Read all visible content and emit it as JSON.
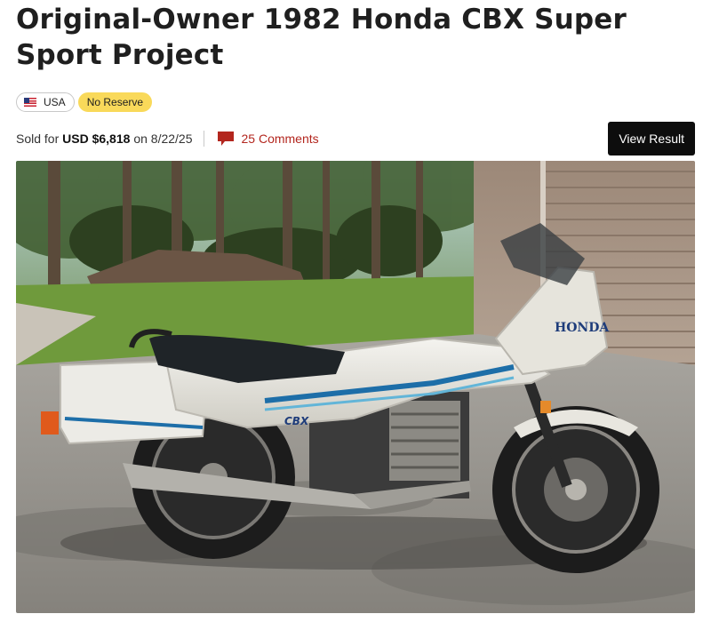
{
  "listing": {
    "title": "Original-Owner 1982 Honda CBX Super Sport Project",
    "tags": {
      "country": "USA",
      "country_flag_icon": "us-flag-icon",
      "reserve": "No Reserve"
    },
    "result": {
      "sold_prefix": "Sold for",
      "price": "USD $6,818",
      "date_prefix": "on",
      "date": "8/22/25"
    },
    "comments": {
      "icon": "comment-bubble-icon",
      "label": "25 Comments"
    },
    "view_result_label": "View Result",
    "photo": {
      "tank_brand": "HONDA",
      "side_badge": "CBX"
    }
  },
  "colors": {
    "comments_link": "#b3261e",
    "reserve_badge": "#f9d95a",
    "button_bg": "#0d0d0d"
  }
}
